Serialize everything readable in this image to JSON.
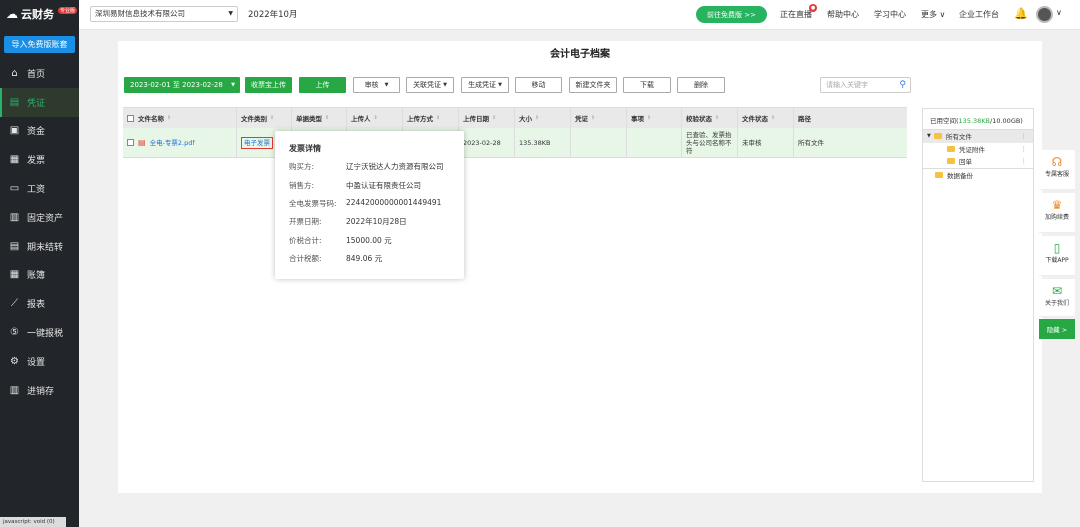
{
  "sidebar": {
    "logo_mark": "☁",
    "logo_text": "云财务",
    "logo_badge": "专业版",
    "import_button": "导入免费版账套",
    "items": [
      {
        "label": "首页",
        "icon": "home-icon",
        "glyph": "⌂",
        "active": false
      },
      {
        "label": "凭证",
        "icon": "voucher-icon",
        "glyph": "▤",
        "active": true
      },
      {
        "label": "资金",
        "icon": "fund-icon",
        "glyph": "▣",
        "active": false
      },
      {
        "label": "发票",
        "icon": "invoice-icon",
        "glyph": "▦",
        "active": false
      },
      {
        "label": "工资",
        "icon": "salary-icon",
        "glyph": "▭",
        "active": false
      },
      {
        "label": "固定资产",
        "icon": "asset-icon",
        "glyph": "▥",
        "active": false
      },
      {
        "label": "期末结转",
        "icon": "period-close-icon",
        "glyph": "▤",
        "active": false
      },
      {
        "label": "账簿",
        "icon": "ledger-icon",
        "glyph": "▦",
        "active": false
      },
      {
        "label": "报表",
        "icon": "report-icon",
        "glyph": "⟋",
        "active": false
      },
      {
        "label": "一键报税",
        "icon": "tax-icon",
        "glyph": "⑤",
        "active": false
      },
      {
        "label": "设置",
        "icon": "settings-icon",
        "glyph": "⚙",
        "active": false
      },
      {
        "label": "进销存",
        "icon": "inventory-icon",
        "glyph": "▥",
        "active": false
      }
    ],
    "status_text": "javascript: void (0)"
  },
  "topbar": {
    "company": "深圳易财信息技术有限公司",
    "period": "2022年10月",
    "free_button": "前往免费版 >>",
    "links": [
      "正在直播",
      "帮助中心",
      "学习中心",
      "更多 ∨",
      "企业工作台"
    ],
    "live_badge": "live"
  },
  "main": {
    "title": "会计电子档案",
    "date_range": "2023-02-01 至 2023-02-28",
    "toolbar": {
      "cloud_upload": "收票宝上传",
      "upload": "上传",
      "review": "审核",
      "link_voucher": "关联凭证",
      "gen_voucher": "生成凭证",
      "move": "移动",
      "new_folder": "新建文件夹",
      "download": "下载",
      "delete": "删除"
    },
    "search_placeholder": "请输入关键字",
    "table": {
      "headers": [
        "文件名称",
        "文件类别",
        "单据类型",
        "上传人",
        "上传方式",
        "上传日期",
        "大小",
        "凭证",
        "事项",
        "校验状态",
        "文件状态",
        "路径"
      ],
      "rows": [
        {
          "file_name": "全电-专票2.pdf",
          "category": "电子发票",
          "doc_type": "",
          "uploader": "",
          "upload_method": "",
          "upload_date": "2023-02-28",
          "size": "135.38KB",
          "voucher": "",
          "matter": "",
          "check_status": "已查验、发票抬头与公司名称不符",
          "file_status": "未审核",
          "path": "所有文件"
        }
      ]
    },
    "popup": {
      "title": "发票详情",
      "fields": [
        {
          "label": "购买方:",
          "value": "辽宁沃锐达人力资源有限公司"
        },
        {
          "label": "销售方:",
          "value": "中盈认证有限责任公司"
        },
        {
          "label": "全电发票号码:",
          "value": "22442000000001449491"
        },
        {
          "label": "开票日期:",
          "value": "2022年10月28日"
        },
        {
          "label": "价税合计:",
          "value": "15000.00 元"
        },
        {
          "label": "合计税额:",
          "value": "849.06 元"
        }
      ]
    }
  },
  "right_panel": {
    "space_prefix": "已用空间(",
    "space_used": "135.38KB",
    "space_suffix": "/10.00GB)",
    "tree": [
      {
        "label": "所有文件",
        "expanded": true
      },
      {
        "label": "凭证附件"
      },
      {
        "label": "回单"
      },
      {
        "label": "数据备份"
      }
    ]
  },
  "float_widgets": [
    {
      "label": "专属客服",
      "icon": "headset-icon",
      "glyph": "☊"
    },
    {
      "label": "加购续费",
      "icon": "shopping-bag-icon",
      "glyph": "♛"
    },
    {
      "label": "下载APP",
      "icon": "phone-icon",
      "glyph": "▯"
    },
    {
      "label": "关于我们",
      "icon": "wechat-icon",
      "glyph": "✉"
    }
  ],
  "hide_button": "隐藏 >"
}
